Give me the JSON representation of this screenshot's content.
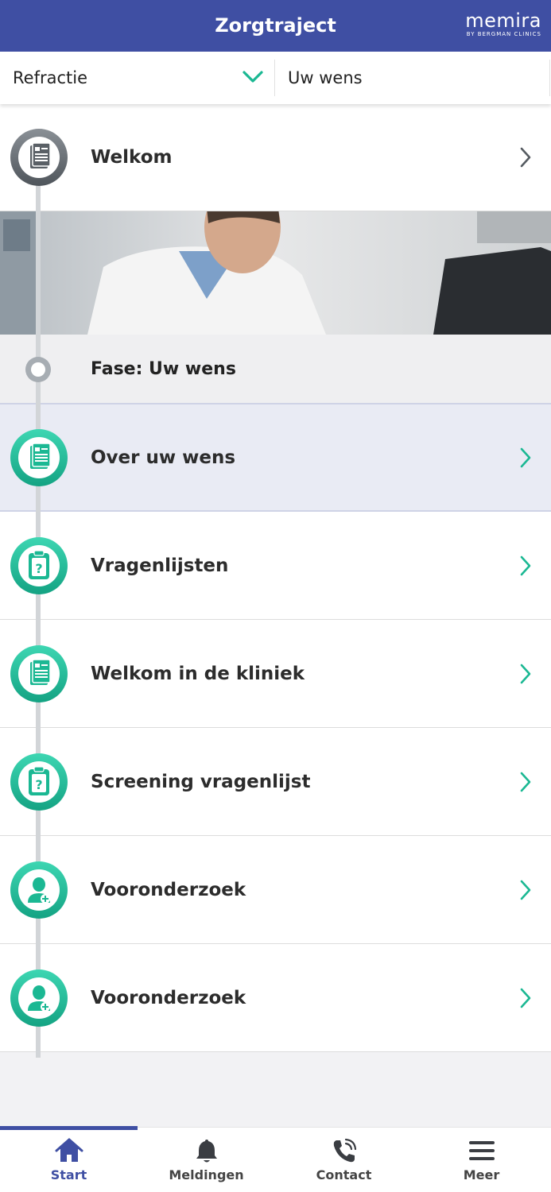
{
  "header": {
    "title": "Zorgtraject",
    "brand_name": "memira",
    "brand_sub": "BY BERGMAN CLINICS"
  },
  "selector": {
    "treatment": "Refractie",
    "phase": "Uw wens"
  },
  "timeline": {
    "welcome": {
      "label": "Welkom",
      "icon": "document-icon"
    },
    "phase_label": "Fase: Uw wens",
    "items": [
      {
        "label": "Over uw wens",
        "icon": "document-icon",
        "highlighted": true
      },
      {
        "label": "Vragenlijsten",
        "icon": "questionnaire-clipboard-icon"
      },
      {
        "label": "Welkom in de kliniek",
        "icon": "document-icon"
      },
      {
        "label": "Screening vragenlijst",
        "icon": "questionnaire-clipboard-icon"
      },
      {
        "label": "Vooronderzoek",
        "icon": "patient-plus-icon"
      },
      {
        "label": "Vooronderzoek",
        "icon": "patient-plus-icon"
      }
    ]
  },
  "bottom_nav": {
    "items": [
      {
        "label": "Start",
        "icon": "home-icon",
        "active": true
      },
      {
        "label": "Meldingen",
        "icon": "bell-icon"
      },
      {
        "label": "Contact",
        "icon": "phone-icon"
      },
      {
        "label": "Meer",
        "icon": "menu-icon"
      }
    ]
  },
  "colors": {
    "primary": "#3f4fa3",
    "accent_teal": "#1bb893",
    "highlight_row": "#e9ebf4"
  }
}
